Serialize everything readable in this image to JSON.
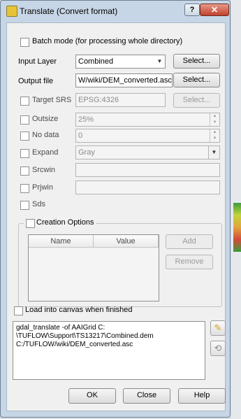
{
  "window": {
    "title": "Translate (Convert format)",
    "help_label": "?",
    "close_label": "✕"
  },
  "batch": {
    "label": "Batch mode (for processing whole directory)"
  },
  "input_layer": {
    "label": "Input Layer",
    "value": "Combined",
    "select_label": "Select..."
  },
  "output_file": {
    "label": "Output file",
    "value": "W/wiki/DEM_converted.asc",
    "select_label": "Select..."
  },
  "target_srs": {
    "label": "Target SRS",
    "value": "EPSG:4326",
    "select_label": "Select..."
  },
  "outsize": {
    "label": "Outsize",
    "value": "25%"
  },
  "nodata": {
    "label": "No data",
    "value": "0"
  },
  "expand": {
    "label": "Expand",
    "value": "Gray"
  },
  "srcwin": {
    "label": "Srcwin"
  },
  "prjwin": {
    "label": "Prjwin"
  },
  "sds": {
    "label": "Sds"
  },
  "creation_options": {
    "label": "Creation Options",
    "columns": [
      "Name",
      "Value"
    ],
    "add_label": "Add",
    "remove_label": "Remove"
  },
  "load_canvas": {
    "label": "Load into canvas when finished"
  },
  "command": {
    "lines": [
      "gdal_translate -of AAIGrid C:",
      "\\TUFLOW\\Support\\TS13217\\Combined.dem",
      "C:/TUFLOW/wiki/DEM_converted.asc"
    ]
  },
  "icons": {
    "edit": "pencil-icon",
    "reset": "reset-icon"
  },
  "footer": {
    "ok_label": "OK",
    "close_label": "Close",
    "help_label": "Help"
  }
}
